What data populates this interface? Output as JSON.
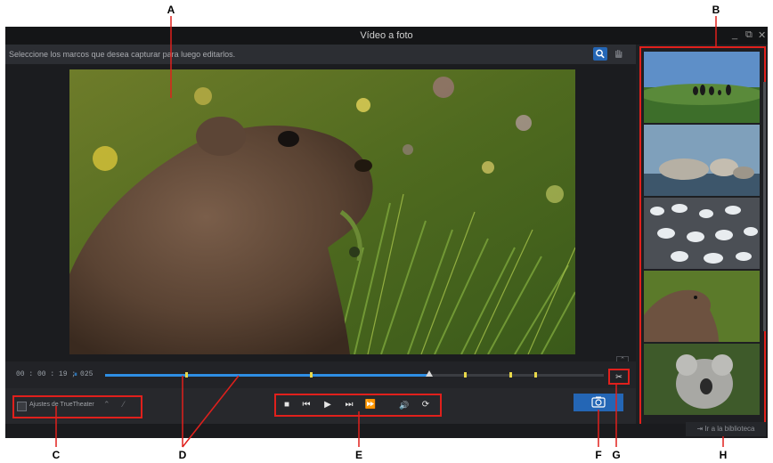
{
  "callouts": {
    "A": "A",
    "B": "B",
    "C": "C",
    "D": "D",
    "E": "E",
    "F": "F",
    "G": "G",
    "H": "H"
  },
  "window": {
    "title": "Vídeo a foto",
    "minimize": "_",
    "restore": "⧉",
    "close": "✕"
  },
  "instruction": "Seleccione los marcos que desea capturar para luego editarlos.",
  "tools": {
    "zoom": "search-icon",
    "hand": "hand-icon"
  },
  "timeline": {
    "timecode": "00 : 00 : 19 ; 025",
    "pause_glyph": "⏸",
    "progress": 0.65,
    "markers": [
      0.16,
      0.41,
      0.72,
      0.81,
      0.86
    ]
  },
  "truetheater": {
    "label": "Ajustes de TrueTheater",
    "checked": false
  },
  "transport": {
    "stop": "■",
    "prev": "⏮",
    "play": "▶",
    "next": "⏭",
    "fastforward": "⏩",
    "volume": "🔊",
    "speed": "⟳"
  },
  "capture_icon": "camera-icon",
  "cut_icon": "scissors-icon",
  "library_button": "Ir a la biblioteca",
  "thumbnails": [
    {
      "name": "puffins-on-grass"
    },
    {
      "name": "seals-on-ice"
    },
    {
      "name": "gannet-colony"
    },
    {
      "name": "marmot"
    },
    {
      "name": "koala"
    }
  ],
  "colors": {
    "accent": "#2466b5",
    "highlight": "#e0201c",
    "background": "#1e1f22"
  }
}
